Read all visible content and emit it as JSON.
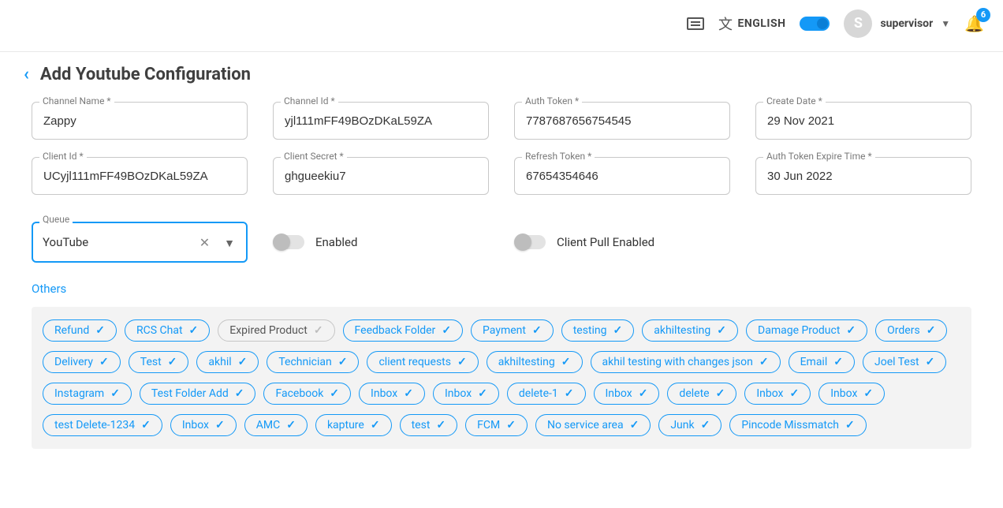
{
  "header": {
    "language": "ENGLISH",
    "translate_icon": "文",
    "user_initial": "S",
    "user_name": "supervisor",
    "notification_count": "6"
  },
  "page": {
    "title": "Add Youtube Configuration"
  },
  "fields": {
    "channel_name": {
      "label": "Channel Name *",
      "value": "Zappy"
    },
    "channel_id": {
      "label": "Channel Id *",
      "value": "yjl111mFF49BOzDKaL59ZA"
    },
    "auth_token": {
      "label": "Auth Token *",
      "value": "7787687656754545"
    },
    "create_date": {
      "label": "Create Date *",
      "value": "29 Nov 2021"
    },
    "client_id": {
      "label": "Client Id *",
      "value": "UCyjl111mFF49BOzDKaL59ZA"
    },
    "client_secret": {
      "label": "Client Secret *",
      "value": "ghgueekiu7"
    },
    "refresh_token": {
      "label": "Refresh Token *",
      "value": "67654354646"
    },
    "auth_expire": {
      "label": "Auth Token Expire Time *",
      "value": "30 Jun 2022"
    }
  },
  "queue": {
    "label": "Queue",
    "value": "YouTube"
  },
  "toggles": {
    "enabled": {
      "label": "Enabled",
      "state": false
    },
    "client_pull": {
      "label": "Client Pull Enabled",
      "state": false
    }
  },
  "others": {
    "title": "Others",
    "chips": [
      {
        "label": "Refund",
        "selected": true
      },
      {
        "label": "RCS Chat",
        "selected": true
      },
      {
        "label": "Expired Product",
        "selected": false
      },
      {
        "label": "Feedback Folder",
        "selected": true
      },
      {
        "label": "Payment",
        "selected": true
      },
      {
        "label": "testing",
        "selected": true
      },
      {
        "label": "akhiltesting",
        "selected": true
      },
      {
        "label": "Damage Product",
        "selected": true
      },
      {
        "label": "Orders",
        "selected": true
      },
      {
        "label": "Delivery",
        "selected": true
      },
      {
        "label": "Test",
        "selected": true
      },
      {
        "label": "akhil",
        "selected": true
      },
      {
        "label": "Technician",
        "selected": true
      },
      {
        "label": "client requests",
        "selected": true
      },
      {
        "label": "akhiltesting",
        "selected": true
      },
      {
        "label": "akhil testing with changes json",
        "selected": true
      },
      {
        "label": "Email",
        "selected": true
      },
      {
        "label": "Joel Test",
        "selected": true
      },
      {
        "label": "Instagram",
        "selected": true
      },
      {
        "label": "Test Folder Add",
        "selected": true
      },
      {
        "label": "Facebook",
        "selected": true
      },
      {
        "label": "Inbox",
        "selected": true
      },
      {
        "label": "Inbox",
        "selected": true
      },
      {
        "label": "delete-1",
        "selected": true
      },
      {
        "label": "Inbox",
        "selected": true
      },
      {
        "label": "delete",
        "selected": true
      },
      {
        "label": "Inbox",
        "selected": true
      },
      {
        "label": "Inbox",
        "selected": true
      },
      {
        "label": "test Delete-1234",
        "selected": true
      },
      {
        "label": "Inbox",
        "selected": true
      },
      {
        "label": "AMC",
        "selected": true
      },
      {
        "label": "kapture",
        "selected": true
      },
      {
        "label": "test",
        "selected": true
      },
      {
        "label": "FCM",
        "selected": true
      },
      {
        "label": "No service area",
        "selected": true
      },
      {
        "label": "Junk",
        "selected": true
      },
      {
        "label": "Pincode Missmatch",
        "selected": true
      }
    ]
  }
}
